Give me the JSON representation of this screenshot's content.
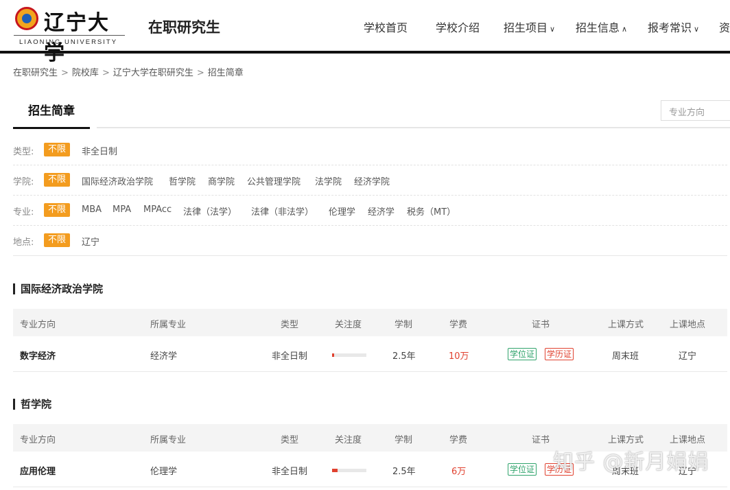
{
  "header": {
    "logo_cn": "辽宁大学",
    "logo_en": "LIAONING UNIVERSITY",
    "site_title": "在职研究生",
    "nav": [
      {
        "label": "学校首页",
        "caret": ""
      },
      {
        "label": "学校介绍",
        "caret": ""
      },
      {
        "label": "招生项目",
        "caret": "∨"
      },
      {
        "label": "招生信息",
        "caret": "∧"
      },
      {
        "label": "报考常识",
        "caret": "∨"
      },
      {
        "label": "资",
        "caret": ""
      }
    ]
  },
  "breadcrumb": [
    "在职研究生",
    "院校库",
    "辽宁大学在职研究生",
    "招生简章"
  ],
  "tab": {
    "active": "招生简章",
    "search_placeholder": "专业方向"
  },
  "filters": [
    {
      "label": "类型:",
      "selected": "不限",
      "options": [
        "非全日制"
      ]
    },
    {
      "label": "学院:",
      "selected": "不限",
      "options": [
        "国际经济政治学院",
        "哲学院",
        "商学院",
        "公共管理学院",
        "法学院",
        "经济学院"
      ]
    },
    {
      "label": "专业:",
      "selected": "不限",
      "options": [
        "MBA",
        "MPA",
        "MPAcc",
        "法律（法学）",
        "法律（非法学）",
        "伦理学",
        "经济学",
        "税务（MT）"
      ]
    },
    {
      "label": "地点:",
      "selected": "不限",
      "options": [
        "辽宁"
      ]
    }
  ],
  "table_headers": [
    "专业方向",
    "所属专业",
    "类型",
    "关注度",
    "学制",
    "学费",
    "证书",
    "上课方式",
    "上课地点"
  ],
  "sections": [
    {
      "title": "国际经济政治学院",
      "rows": [
        {
          "direction": "数字经济",
          "major": "经济学",
          "type": "非全日制",
          "attention": 0.06,
          "duration": "2.5年",
          "fee": "10万",
          "cert1": "学位证",
          "cert2": "学历证",
          "mode": "周末班",
          "location": "辽宁"
        }
      ]
    },
    {
      "title": "哲学院",
      "rows": [
        {
          "direction": "应用伦理",
          "major": "伦理学",
          "type": "非全日制",
          "attention": 0.16,
          "duration": "2.5年",
          "fee": "6万",
          "cert1": "学位证",
          "cert2": "学历证",
          "mode": "周末班",
          "location": "辽宁"
        }
      ]
    }
  ],
  "watermark": "知乎 @新月娟娟",
  "colors": {
    "accent": "#f39c1f",
    "fee": "#e0412f",
    "cert_green": "#2fa36b"
  }
}
